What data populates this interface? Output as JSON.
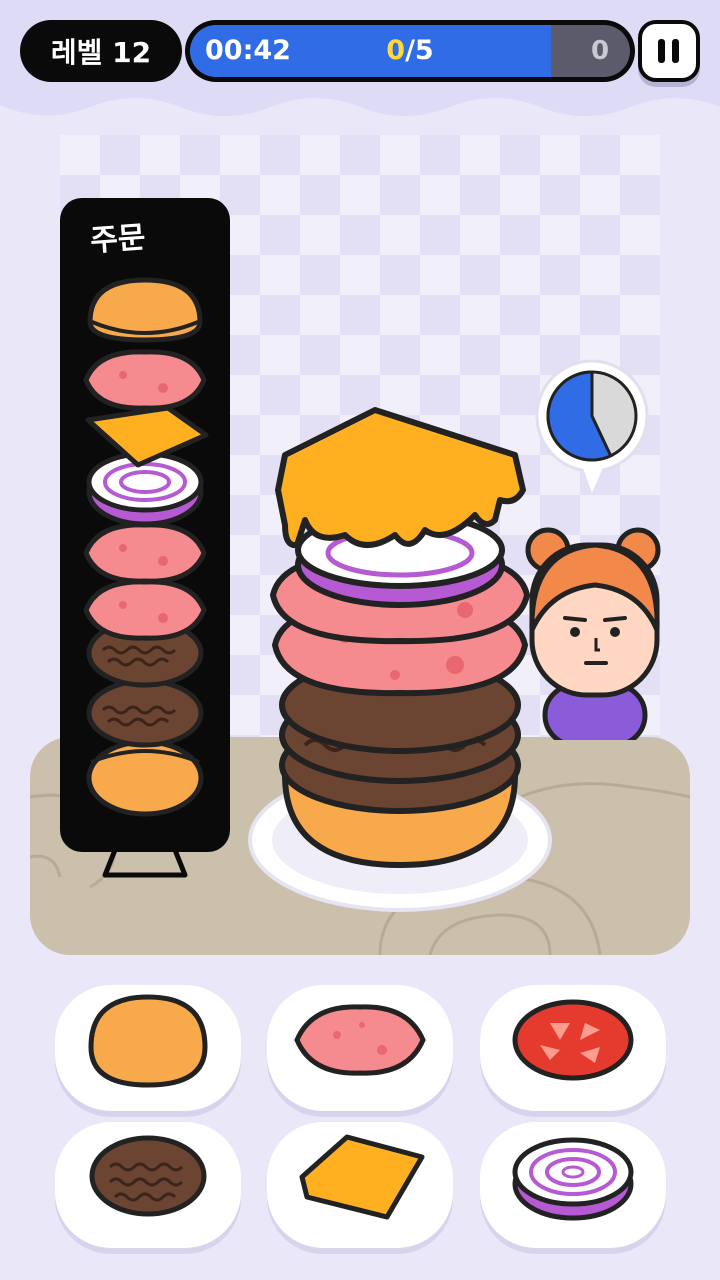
{
  "hud": {
    "level_label": "레벨 12",
    "timer": "00:42",
    "orders_done": "0",
    "orders_total_suffix": "/5",
    "score": "0",
    "timer_remaining_fraction": 0.82
  },
  "order": {
    "title": "주문",
    "layers": [
      "bun-top",
      "ham",
      "cheese",
      "onion",
      "ham",
      "ham",
      "patty",
      "patty",
      "bun-bottom"
    ]
  },
  "customer": {
    "patience_fraction": 0.57
  },
  "built_stack": [
    "bun-bottom",
    "patty",
    "patty",
    "patty",
    "ham",
    "ham",
    "onion",
    "cheese"
  ],
  "ingredients": [
    {
      "id": "bun",
      "icon": "bun-icon"
    },
    {
      "id": "ham",
      "icon": "ham-icon"
    },
    {
      "id": "tomato",
      "icon": "tomato-icon"
    },
    {
      "id": "patty",
      "icon": "patty-icon"
    },
    {
      "id": "cheese",
      "icon": "cheese-icon"
    },
    {
      "id": "onion",
      "icon": "onion-icon"
    }
  ],
  "colors": {
    "accent_blue": "#2f6ce6",
    "count_yellow": "#ffd93b",
    "bun": "#f7a94b",
    "ham": "#f58a8f",
    "cheese": "#ffb020",
    "onion": "#b65ad3",
    "patty": "#6b4532",
    "tomato": "#e53b2f"
  }
}
